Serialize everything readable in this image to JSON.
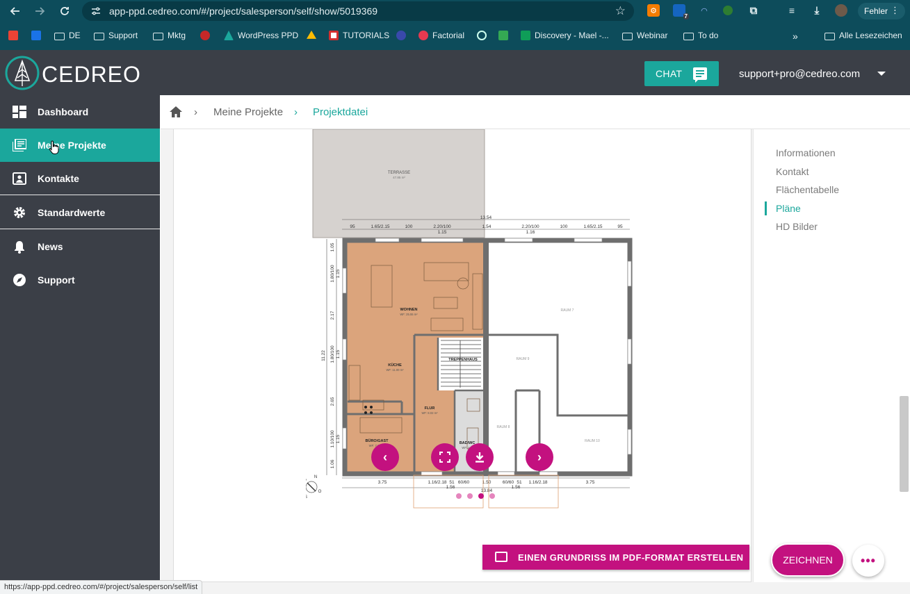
{
  "browser": {
    "url": "app-ppd.cedreo.com/#/project/salesperson/self/show/5019369",
    "profile_status": "Fehler",
    "extension_badge": "7",
    "bookmarks": [
      {
        "label": "DE",
        "type": "folder"
      },
      {
        "label": "Support",
        "type": "folder"
      },
      {
        "label": "Mktg",
        "type": "folder"
      },
      {
        "label": "WordPress PPD",
        "type": "site"
      },
      {
        "label": "TUTORIALS",
        "type": "site"
      },
      {
        "label": "Factorial",
        "type": "site"
      },
      {
        "label": "Discovery - Mael -...",
        "type": "site"
      },
      {
        "label": "Webinar",
        "type": "folder"
      },
      {
        "label": "To do",
        "type": "folder"
      },
      {
        "label": "Alle Lesezeichen",
        "type": "folder"
      }
    ],
    "status_url": "https://app-ppd.cedreo.com/#/project/salesperson/self/list"
  },
  "app": {
    "logo_text": "CEDREO",
    "chat_label": "CHAT",
    "user_email": "support+pro@cedreo.com"
  },
  "sidebar": {
    "items": [
      {
        "label": "Dashboard",
        "icon": "dashboard-icon"
      },
      {
        "label": "Meine Projekte",
        "icon": "projects-icon"
      },
      {
        "label": "Kontakte",
        "icon": "contacts-icon"
      },
      {
        "label": "Standardwerte",
        "icon": "gear-icon"
      },
      {
        "label": "News",
        "icon": "bell-icon"
      },
      {
        "label": "Support",
        "icon": "compass-icon"
      }
    ]
  },
  "breadcrumb": {
    "items": [
      "Meine Projekte",
      "Projektdatei"
    ]
  },
  "toc": {
    "items": [
      "Informationen",
      "Kontakt",
      "Flächentabelle",
      "Pläne",
      "HD Bilder"
    ],
    "active_index": 3
  },
  "plan": {
    "rooms": {
      "terrace": "TERRASSE",
      "terrace_area": "47.85 m²",
      "living": "WOHNEN",
      "living_area": "WF: 25.55 m²",
      "kitchen": "KÜCHE",
      "kitchen_area": "WF: 11.00 m²",
      "stairs": "TREPPENHAUS",
      "hall": "FLUR",
      "hall_area": "WF: 8.02 m²",
      "office": "BÜRO/GAST",
      "office_area": "WF: 7.2",
      "bath": "BAD/WC",
      "bath_area": "WF: 4",
      "room7": "RAUM 7",
      "room8": "RAUM 8",
      "room9": "RAUM 9",
      "room10": "RAUM 10"
    },
    "dims_top": {
      "total": "13.54",
      "row": [
        "95",
        "1.65/2.15",
        "100",
        "2.20/100",
        "1.54",
        "2.20/100",
        "100",
        "1.65/2.15",
        "95"
      ],
      "sub": [
        "1.15",
        "1.16"
      ]
    },
    "dims_left": [
      "1.05",
      "1.80/100",
      "1.15",
      "2.17",
      "1.80/100",
      "1.15",
      "2.65",
      "1.10/100",
      "1.15",
      "1.06"
    ],
    "dims_left_total": "11.22",
    "dims_bottom": {
      "row": [
        "3.75",
        "1.16/2.18",
        "51",
        "60/60",
        "1.50",
        "60/60",
        "51",
        "1.16/2.18",
        "3.75"
      ],
      "sub": [
        "1.56",
        "1.56"
      ],
      "total": "13.84"
    },
    "compass": [
      "N",
      "W",
      "S",
      "O"
    ]
  },
  "carousel": {
    "slides": 4,
    "active_index": 2
  },
  "actions": {
    "pdf_label": "EINEN GRUNDRISS IM PDF-FORMAT ERSTELLEN",
    "zeichnen_label": "ZEICHNEN",
    "more_label": "•••"
  },
  "colors": {
    "teal": "#1ba79c",
    "magenta": "#c3117f",
    "sidebar": "#3b3f47",
    "chrome": "#0d4c5b",
    "room_fill": "#dba47c"
  }
}
